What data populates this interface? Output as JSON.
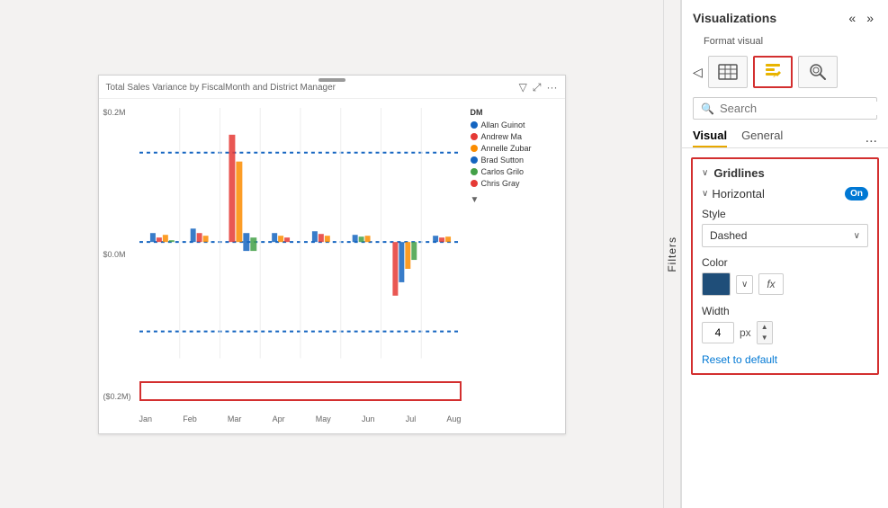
{
  "chart": {
    "title": "Total Sales Variance by FiscalMonth and District Manager",
    "y_labels": [
      "$0.2M",
      "$0.0M",
      "($0.2M)"
    ],
    "x_labels": [
      "Jan",
      "Feb",
      "Mar",
      "Apr",
      "May",
      "Jun",
      "Jul",
      "Aug"
    ],
    "legend_title": "DM",
    "legend_items": [
      {
        "name": "Allan Guinot",
        "color": "#1565c0"
      },
      {
        "name": "Andrew Ma",
        "color": "#e53935"
      },
      {
        "name": "Annelle Zubar",
        "color": "#fb8c00"
      },
      {
        "name": "Brad Sutton",
        "color": "#1565c0"
      },
      {
        "name": "Carlos Grilo",
        "color": "#43a047"
      },
      {
        "name": "Chris Gray",
        "color": "#e53935"
      }
    ],
    "resize_handle": true
  },
  "filters": {
    "label": "Filters"
  },
  "viz_panel": {
    "title": "Visualizations",
    "format_visual_label": "Format visual",
    "nav_left": "«",
    "nav_right": "»",
    "nav_back": "◁",
    "icons": [
      {
        "name": "table-icon",
        "symbol": "⊞",
        "active": false
      },
      {
        "name": "format-icon",
        "symbol": "📊",
        "active": true
      },
      {
        "name": "analytics-icon",
        "symbol": "🔍",
        "active": false
      }
    ],
    "search_placeholder": "Search",
    "tabs": [
      {
        "label": "Visual",
        "active": true
      },
      {
        "label": "General",
        "active": false
      }
    ],
    "tab_more": "...",
    "gridlines_section": {
      "title": "Gridlines",
      "chevron": "∨",
      "horizontal": {
        "title": "Horizontal",
        "chevron": "∨",
        "toggle": "On",
        "style_label": "Style",
        "style_value": "Dashed",
        "color_label": "Color",
        "width_label": "Width",
        "width_value": "4",
        "width_unit": "px",
        "reset_label": "Reset to default"
      }
    }
  }
}
